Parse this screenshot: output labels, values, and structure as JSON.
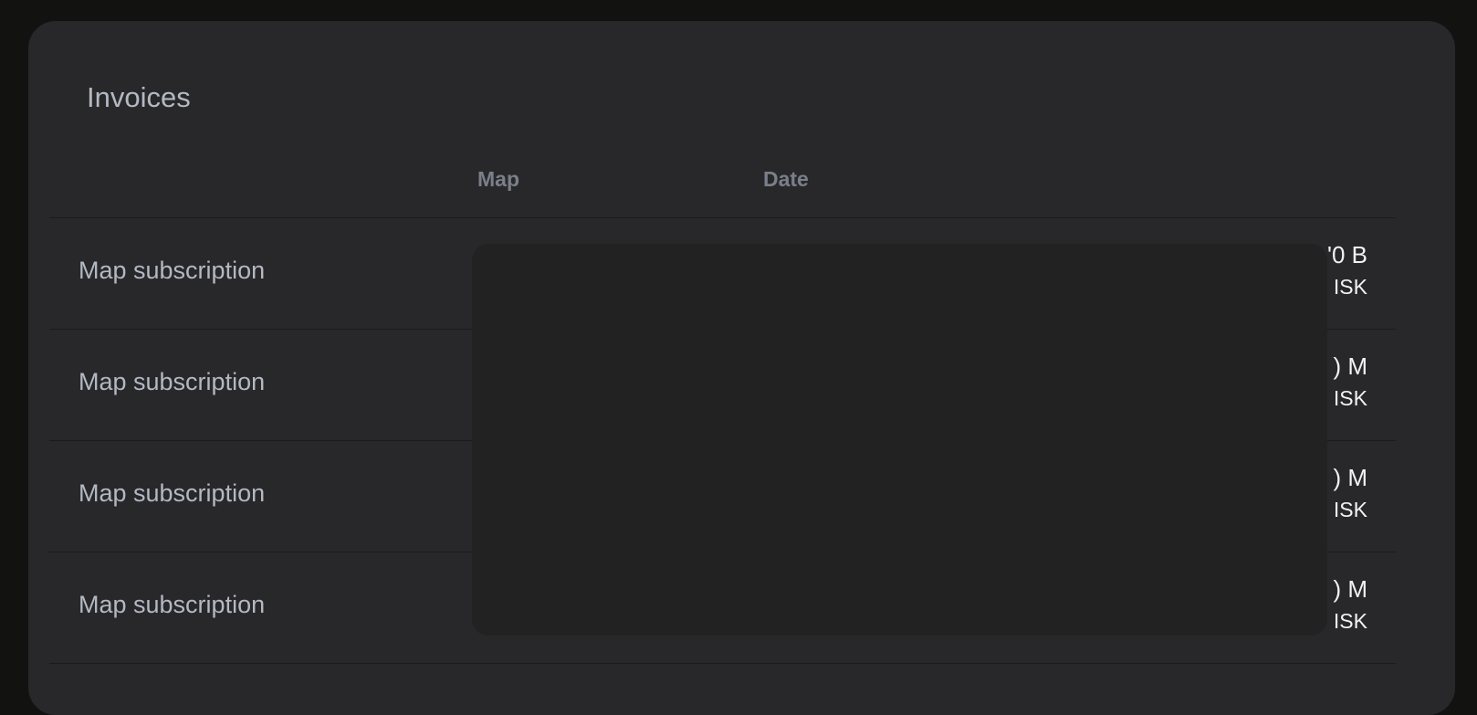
{
  "invoices": {
    "title": "Invoices",
    "columns": {
      "description": "",
      "map": "Map",
      "date": "Date",
      "amount": ""
    },
    "rows": [
      {
        "description": "Map subscription",
        "amount": "'0 B",
        "currency": "ISK"
      },
      {
        "description": "Map subscription",
        "amount": ") M",
        "currency": "ISK"
      },
      {
        "description": "Map subscription",
        "amount": ") M",
        "currency": "ISK"
      },
      {
        "description": "Map subscription",
        "amount": ") M",
        "currency": "ISK"
      }
    ]
  },
  "colors": {
    "page_background": "#121211",
    "card_background": "#28282b",
    "title_text": "#b3b8c2",
    "header_text": "#7a7f89",
    "amount_text": "#f2f2f4",
    "redaction": "#222223"
  }
}
